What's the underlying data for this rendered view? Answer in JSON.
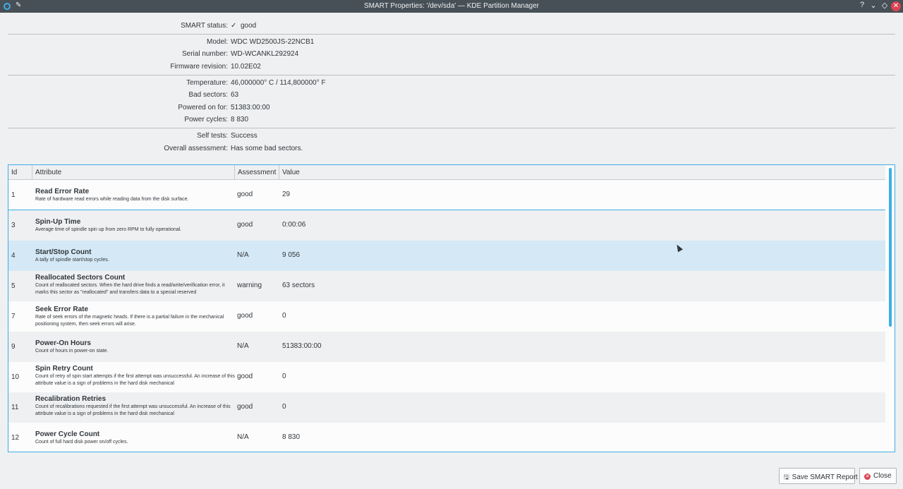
{
  "window": {
    "title": "SMART Properties: '/dev/sda' — KDE Partition Manager",
    "buttons": {
      "help": "?",
      "minimize": "⌄",
      "maximize": "◇",
      "close": "✕"
    }
  },
  "info": {
    "smart_status": {
      "label": "SMART status:",
      "value": "good",
      "icon": "✓"
    },
    "model": {
      "label": "Model:",
      "value": "WDC WD2500JS-22NCB1"
    },
    "serial": {
      "label": "Serial number:",
      "value": "WD-WCANKL292924"
    },
    "firmware": {
      "label": "Firmware revision:",
      "value": "10.02E02"
    },
    "temperature": {
      "label": "Temperature:",
      "value": "46,000000° C / 114,800000° F"
    },
    "bad_sectors": {
      "label": "Bad sectors:",
      "value": "63"
    },
    "powered_on": {
      "label": "Powered on for:",
      "value": "51383:00:00"
    },
    "power_cycles": {
      "label": "Power cycles:",
      "value": "8 830"
    },
    "self_tests": {
      "label": "Self tests:",
      "value": "Success"
    },
    "overall": {
      "label": "Overall assessment:",
      "value": "Has some bad sectors."
    }
  },
  "table": {
    "headers": {
      "id": "Id",
      "attribute": "Attribute",
      "assessment": "Assessment",
      "value": "Value"
    },
    "rows": [
      {
        "id": "1",
        "name": "Read Error Rate",
        "desc": "Rate of hardware read errors while reading data from the disk surface.",
        "assessment": "good",
        "value": "29"
      },
      {
        "id": "3",
        "name": "Spin-Up Time",
        "desc": "Average time of spindle spin up from zero RPM to fully operational.",
        "assessment": "good",
        "value": "0:00:06"
      },
      {
        "id": "4",
        "name": "Start/Stop Count",
        "desc": "A tally of spindle start/stop cycles.",
        "assessment": "N/A",
        "value": "9 056"
      },
      {
        "id": "5",
        "name": "Reallocated Sectors Count",
        "desc": "Count of reallocated sectors. When the hard drive finds a read/write/verification error, it marks this sector as \"reallocated\" and transfers data to a special reserved",
        "assessment": "warning",
        "value": "63 sectors"
      },
      {
        "id": "7",
        "name": "Seek Error Rate",
        "desc": "Rate of seek errors of the magnetic heads. If there is a partial failure in the mechanical positioning system, then seek errors will arise.",
        "assessment": "good",
        "value": "0"
      },
      {
        "id": "9",
        "name": "Power-On Hours",
        "desc": "Count of hours in power-on state.",
        "assessment": "N/A",
        "value": "51383:00:00"
      },
      {
        "id": "10",
        "name": "Spin Retry Count",
        "desc": "Count of retry of spin start attempts if the first attempt was unsuccessful. An increase of this attribute value is a sign of problems in the hard disk mechanical",
        "assessment": "good",
        "value": "0"
      },
      {
        "id": "11",
        "name": "Recalibration Retries",
        "desc": "Count of recalibrations requested if the first attempt was unsuccessful. An increase of this attribute value is a sign of problems in the hard disk mechanical",
        "assessment": "good",
        "value": "0"
      },
      {
        "id": "12",
        "name": "Power Cycle Count",
        "desc": "Count of full hard disk power on/off cycles.",
        "assessment": "N/A",
        "value": "8 830"
      }
    ]
  },
  "footer": {
    "save_label": "Save SMART Report",
    "close_label": "Close"
  },
  "colors": {
    "accent": "#3daee9",
    "titlebar": "#475057",
    "close": "#da4453"
  }
}
